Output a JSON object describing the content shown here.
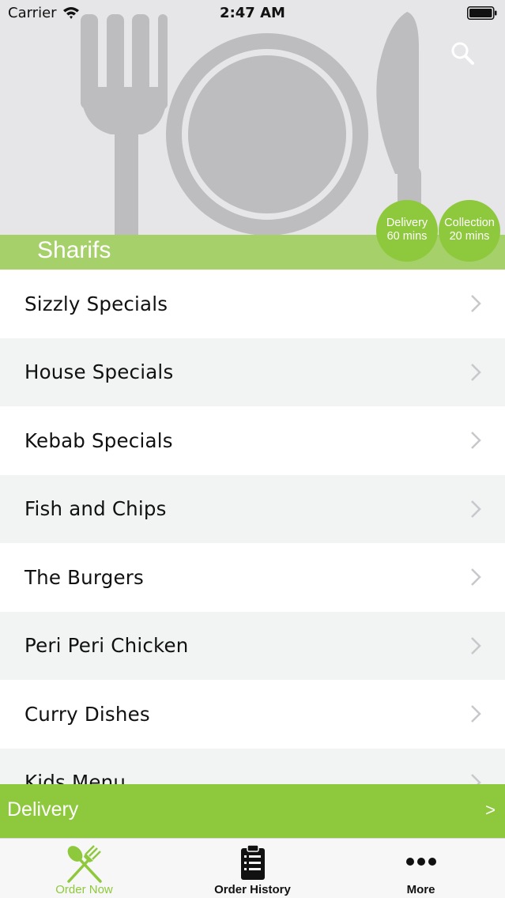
{
  "status_bar": {
    "carrier": "Carrier",
    "time": "2:47 AM"
  },
  "header": {
    "restaurant_name": "Sharifs",
    "search_icon": "search-icon",
    "delivery_badge": {
      "label": "Delivery",
      "time": "60 mins"
    },
    "collection_badge": {
      "label": "Collection",
      "time": "20 mins"
    }
  },
  "menu": {
    "items": [
      {
        "label": "Sizzly Specials"
      },
      {
        "label": "House Specials"
      },
      {
        "label": "Kebab Specials"
      },
      {
        "label": "Fish and Chips"
      },
      {
        "label": "The Burgers"
      },
      {
        "label": "Peri Peri Chicken"
      },
      {
        "label": "Curry Dishes"
      },
      {
        "label": "Kids Menu"
      }
    ]
  },
  "delivery_bar": {
    "label": "Delivery",
    "arrow": ">"
  },
  "tab_bar": {
    "tabs": [
      {
        "label": "Order Now",
        "icon": "fork-knife-icon"
      },
      {
        "label": "Order History",
        "icon": "clipboard-icon"
      },
      {
        "label": "More",
        "icon": "more-dots-icon"
      }
    ]
  },
  "colors": {
    "accent_green": "#8ec83c",
    "band_green": "#a6d16a",
    "header_bg": "#e6e6e8"
  }
}
